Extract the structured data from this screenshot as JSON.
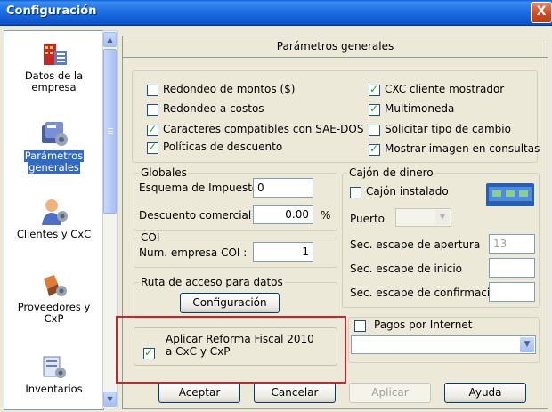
{
  "window": {
    "title": "Configuración",
    "close_glyph": "X"
  },
  "sidebar": {
    "items": [
      {
        "label_1": "Datos de la",
        "label_2": "empresa",
        "icon": "building-icon",
        "selected": false
      },
      {
        "label_1": "Parámetros",
        "label_2": "generales",
        "icon": "gears-icon",
        "selected": true
      },
      {
        "label_1": "Clientes y CxC",
        "label_2": "",
        "icon": "customer-icon",
        "selected": false
      },
      {
        "label_1": "Proveedores y",
        "label_2": "CxP",
        "icon": "supplier-icon",
        "selected": false
      },
      {
        "label_1": "Inventarios",
        "label_2": "",
        "icon": "inventory-icon",
        "selected": false
      }
    ]
  },
  "panel": {
    "title": "Parámetros generales"
  },
  "options": {
    "left": [
      {
        "label": "Redondeo de montos ($)",
        "checked": false
      },
      {
        "label": "Redondeo a costos",
        "checked": false
      },
      {
        "label": "Caracteres compatibles con SAE-DOS",
        "checked": true
      },
      {
        "label": "Políticas de descuento",
        "checked": true
      }
    ],
    "right": [
      {
        "label": "CXC cliente mostrador",
        "checked": true
      },
      {
        "label": "Multimoneda",
        "checked": true
      },
      {
        "label": "Solicitar tipo de cambio",
        "checked": false
      },
      {
        "label": "Mostrar imagen en consultas",
        "checked": true
      }
    ]
  },
  "globales": {
    "legend": "Globales",
    "esquema_label": "Esquema de Impuesto",
    "esquema_value": "0",
    "descuento_label": "Descuento comercial",
    "descuento_value": "0.00",
    "percent": "%"
  },
  "coi": {
    "legend": "COI",
    "label": "Num. empresa COI :",
    "value": "1"
  },
  "ruta": {
    "legend": "Ruta de acceso para datos",
    "button": "Configuración"
  },
  "reforma": {
    "label_1": "Aplicar Reforma Fiscal 2010",
    "label_2": "a CxC y CxP",
    "checked": true
  },
  "cajon": {
    "legend": "Cajón de dinero",
    "instalado_label": "Cajón instalado",
    "instalado_checked": false,
    "puerto_label": "Puerto",
    "puerto_value": "",
    "apertura_label": "Sec. escape de apertura",
    "apertura_value": "13",
    "inicio_label": "Sec. escape de inicio",
    "inicio_value": "",
    "confirmacion_label": "Sec. escape de confirmación",
    "confirmacion_value": ""
  },
  "pagos": {
    "label": "Pagos por Internet",
    "checked": false,
    "select_value": ""
  },
  "buttons": {
    "aceptar": "Aceptar",
    "cancelar": "Cancelar",
    "aplicar": "Aplicar",
    "ayuda": "Ayuda"
  },
  "colors": {
    "titlebar": "#0a4fc8",
    "selection": "#316ac5",
    "highlight_box": "#c0282d",
    "dialog_bg": "#ece9d8"
  }
}
